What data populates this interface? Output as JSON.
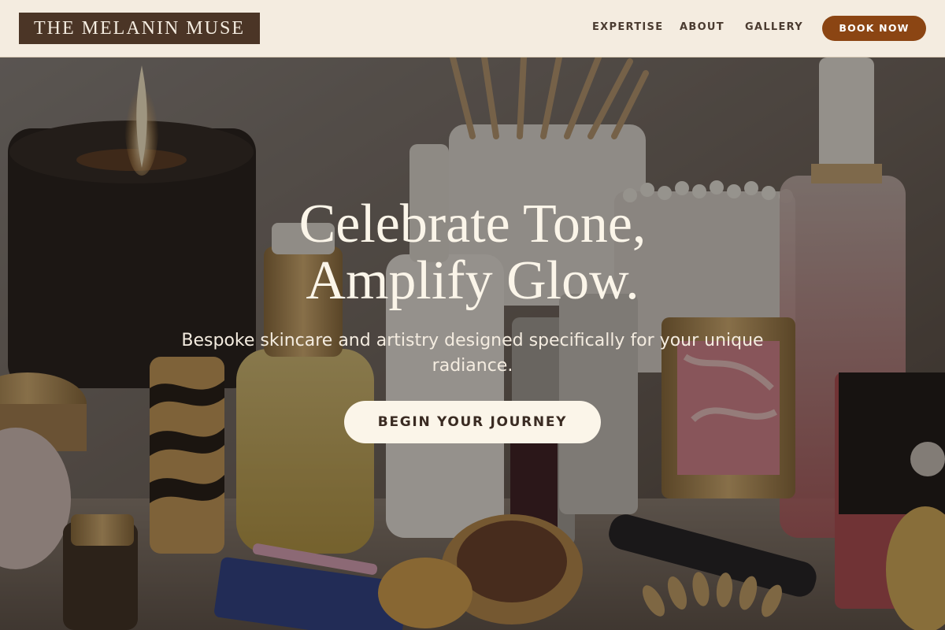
{
  "header": {
    "logo": "THE MELANIN MUSE",
    "nav": {
      "expertise": "EXPERTISE",
      "about": "ABOUT",
      "gallery": "GALLERY"
    },
    "book_now": "BOOK NOW"
  },
  "hero": {
    "title_line1": "Celebrate Tone,",
    "title_line2": "Amplify Glow.",
    "subtitle": "Bespoke skincare and artistry designed specifically for your unique radiance.",
    "cta": "BEGIN YOUR JOURNEY"
  },
  "colors": {
    "header_bg": "#f4ece0",
    "logo_bg": "#4b3526",
    "accent": "#8b4513",
    "cta_bg": "#fbf5e9",
    "nav_text": "#4a3b30"
  }
}
